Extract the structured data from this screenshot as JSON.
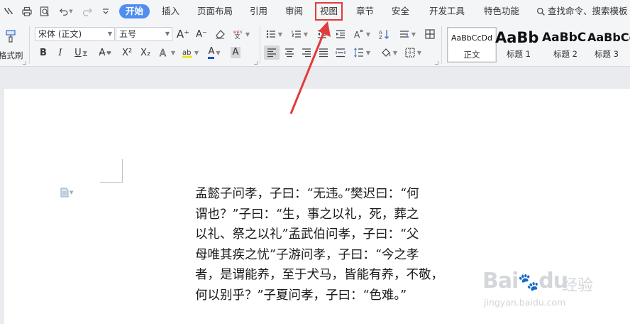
{
  "menubar": {
    "tabs": [
      {
        "label": "开始",
        "state": "active"
      },
      {
        "label": "插入"
      },
      {
        "label": "页面布局"
      },
      {
        "label": "引用"
      },
      {
        "label": "审阅"
      },
      {
        "label": "视图",
        "state": "highlighted"
      },
      {
        "label": "章节"
      },
      {
        "label": "安全"
      },
      {
        "label": "开发工具"
      },
      {
        "label": "特色功能"
      }
    ],
    "search_label": "查找命令、搜索模板"
  },
  "ribbon": {
    "format_painter_label": "格式刷",
    "font_name": "宋体 (正文)",
    "font_size": "五号",
    "bold": "B",
    "italic": "I",
    "underline": "U",
    "strikethrough": "A",
    "superscript": "X²",
    "subscript": "X₂",
    "grow_font": "A⁺",
    "shrink_font": "A⁻",
    "font_color_letter": "A",
    "char_shading_letter": "A",
    "styles": [
      {
        "sample": "AaBbCcDd",
        "name": "正文"
      },
      {
        "sample": "AaBb",
        "name": "标题 1"
      },
      {
        "sample": "AaBbC",
        "name": "标题 2"
      },
      {
        "sample": "AaBbCc",
        "name": "标题 3"
      }
    ]
  },
  "document": {
    "lines": [
      "孟懿子问孝，子曰：“无违。”樊迟曰：“何",
      "谓也？”子曰：“生，事之以礼，死，葬之",
      "以礼、祭之以礼”孟武伯问孝，子曰：“父",
      "母唯其疾之忧”子游问孝，子曰：“今之孝",
      "者，是谓能养，至于犬马，皆能有养，不敬，",
      "何以别乎？”子夏问孝，子曰：“色难。”"
    ]
  },
  "watermark": {
    "brand": "Bai",
    "brand2": "du",
    "cn": "经验",
    "url": "jingyan.baidu.com"
  },
  "colors": {
    "active_tab": "#4f8ef0",
    "highlight_box": "#e23b3b",
    "arrow": "#e23b3b"
  }
}
